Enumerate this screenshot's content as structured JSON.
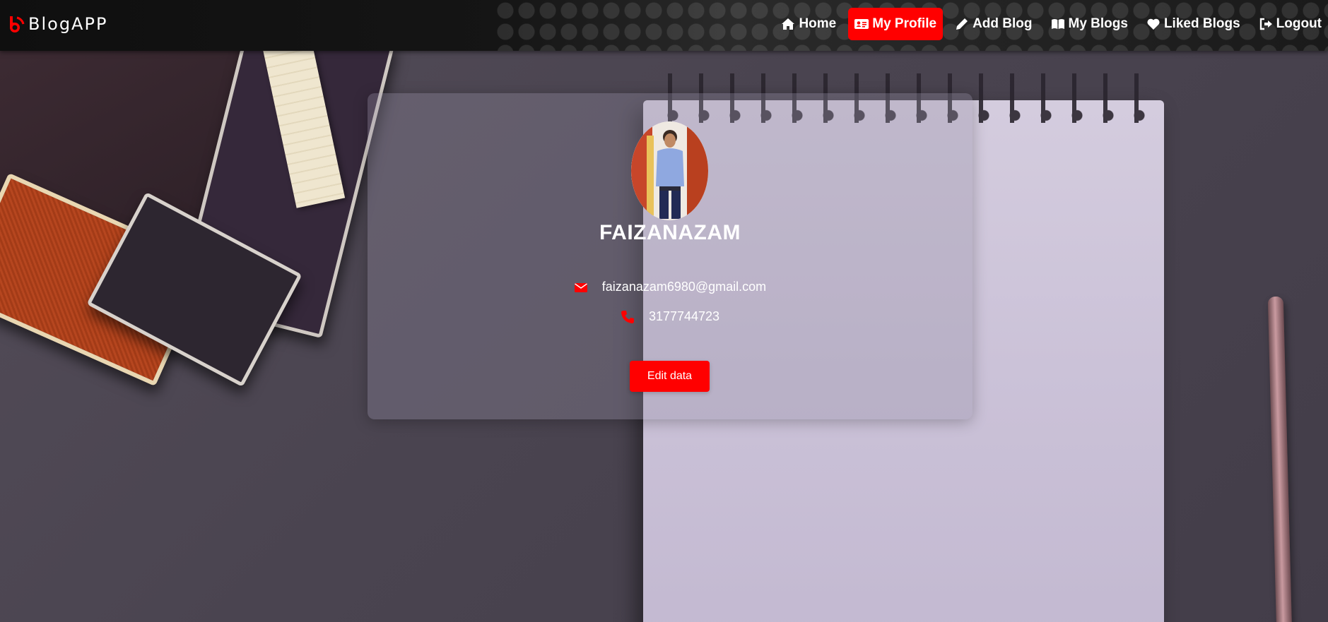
{
  "brand": {
    "name": "BlogAPP",
    "accent": "#ff0000"
  },
  "nav": {
    "items": [
      {
        "label": "Home",
        "icon": "home-icon",
        "active": false
      },
      {
        "label": "My Profile",
        "icon": "profile-card-icon",
        "active": true
      },
      {
        "label": "Add Blog",
        "icon": "pencil-icon",
        "active": false
      },
      {
        "label": "My Blogs",
        "icon": "book-icon",
        "active": false
      },
      {
        "label": "Liked Blogs",
        "icon": "heart-icon",
        "active": false
      },
      {
        "label": "Logout",
        "icon": "logout-icon",
        "active": false
      }
    ]
  },
  "profile": {
    "name": "FAIZANAZAM",
    "email": "faizanazam6980@gmail.com",
    "phone": "3177744723",
    "edit_label": "Edit data",
    "avatar_icon": "avatar-photo"
  },
  "colors": {
    "accent": "#ff0000",
    "navbar": "#111111",
    "text": "#ffffff"
  }
}
